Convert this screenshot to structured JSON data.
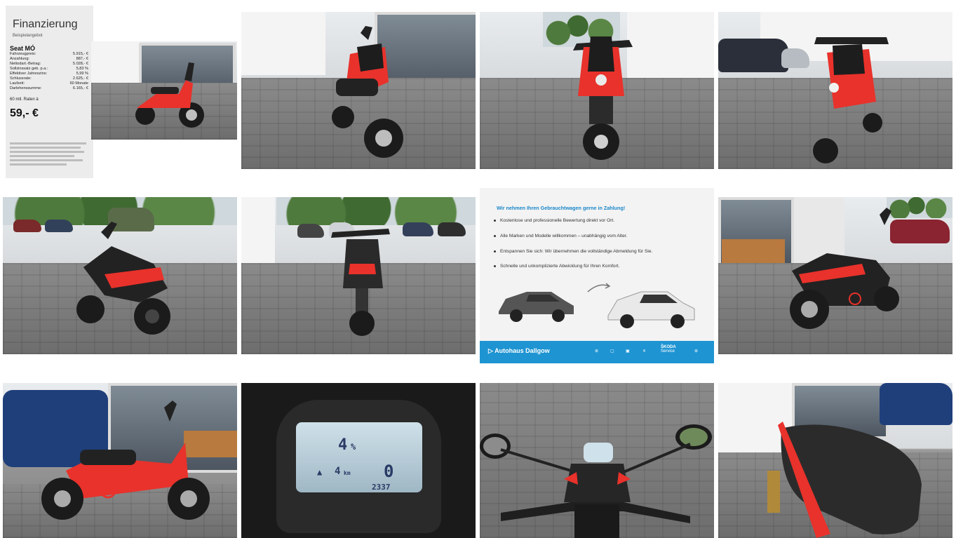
{
  "financing": {
    "title": "Finanzierung",
    "subtitle": "Beispielangebot",
    "model": "Seat MÓ",
    "rows": [
      {
        "label": "Fahrzeugpreis:",
        "value": "5.915,- €"
      },
      {
        "label": "Anzahlung:",
        "value": "887,- €"
      },
      {
        "label": "Nettodarl.-Betrag:",
        "value": "5.028,- €"
      },
      {
        "label": "Sollzinssatz geb. p.a.:",
        "value": "5,83 %"
      },
      {
        "label": "Effektiver Jahreszins:",
        "value": "5,99 %"
      },
      {
        "label": "Schlussrate:",
        "value": "2.625,- €"
      },
      {
        "label": "Laufzeit:",
        "value": "60 Monate"
      },
      {
        "label": "Darlehenssumme:",
        "value": "6.165,- €"
      }
    ],
    "rates_label": "60 mtl. Raten à",
    "monthly_rate": "59,- €"
  },
  "tradein_ad": {
    "headline": "Wir nehmen Ihren Gebrauchtwagen gerne in Zahlung!",
    "bullets": [
      "Kostenlose und professionelle Bewertung direkt vor Ort.",
      "Alle Marken und Modelle willkommen – unabhängig vom Alter.",
      "Entspannen Sie sich: Wir übernehmen die vollständige Abmeldung für Sie.",
      "Schnelle und unkomplizierte Abwicklung für Ihren Komfort."
    ],
    "dealer": "Autohaus Dallgow",
    "brand_label": "ŠKODA",
    "brand_sub": "Service"
  },
  "dashboard": {
    "battery": "4",
    "unit": "%",
    "range": "4",
    "range_unit": "km",
    "speed": "0",
    "odometer": "2337"
  },
  "colors": {
    "scooter_red": "#e8322b",
    "ad_blue": "#1e94d2"
  }
}
